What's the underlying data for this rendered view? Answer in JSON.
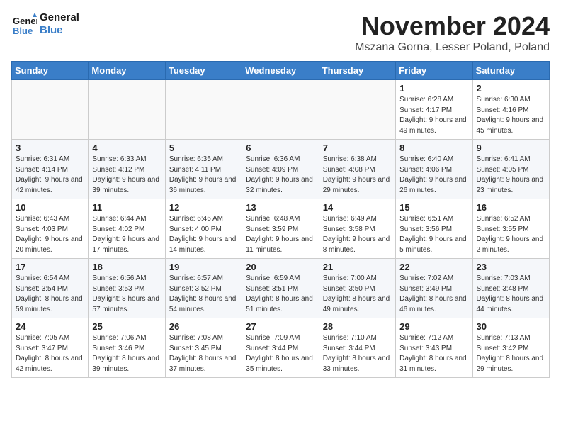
{
  "header": {
    "logo_line1": "General",
    "logo_line2": "Blue",
    "month": "November 2024",
    "location": "Mszana Gorna, Lesser Poland, Poland"
  },
  "weekdays": [
    "Sunday",
    "Monday",
    "Tuesday",
    "Wednesday",
    "Thursday",
    "Friday",
    "Saturday"
  ],
  "rows": [
    [
      {
        "day": "",
        "info": ""
      },
      {
        "day": "",
        "info": ""
      },
      {
        "day": "",
        "info": ""
      },
      {
        "day": "",
        "info": ""
      },
      {
        "day": "",
        "info": ""
      },
      {
        "day": "1",
        "info": "Sunrise: 6:28 AM\nSunset: 4:17 PM\nDaylight: 9 hours\nand 49 minutes."
      },
      {
        "day": "2",
        "info": "Sunrise: 6:30 AM\nSunset: 4:16 PM\nDaylight: 9 hours\nand 45 minutes."
      }
    ],
    [
      {
        "day": "3",
        "info": "Sunrise: 6:31 AM\nSunset: 4:14 PM\nDaylight: 9 hours\nand 42 minutes."
      },
      {
        "day": "4",
        "info": "Sunrise: 6:33 AM\nSunset: 4:12 PM\nDaylight: 9 hours\nand 39 minutes."
      },
      {
        "day": "5",
        "info": "Sunrise: 6:35 AM\nSunset: 4:11 PM\nDaylight: 9 hours\nand 36 minutes."
      },
      {
        "day": "6",
        "info": "Sunrise: 6:36 AM\nSunset: 4:09 PM\nDaylight: 9 hours\nand 32 minutes."
      },
      {
        "day": "7",
        "info": "Sunrise: 6:38 AM\nSunset: 4:08 PM\nDaylight: 9 hours\nand 29 minutes."
      },
      {
        "day": "8",
        "info": "Sunrise: 6:40 AM\nSunset: 4:06 PM\nDaylight: 9 hours\nand 26 minutes."
      },
      {
        "day": "9",
        "info": "Sunrise: 6:41 AM\nSunset: 4:05 PM\nDaylight: 9 hours\nand 23 minutes."
      }
    ],
    [
      {
        "day": "10",
        "info": "Sunrise: 6:43 AM\nSunset: 4:03 PM\nDaylight: 9 hours\nand 20 minutes."
      },
      {
        "day": "11",
        "info": "Sunrise: 6:44 AM\nSunset: 4:02 PM\nDaylight: 9 hours\nand 17 minutes."
      },
      {
        "day": "12",
        "info": "Sunrise: 6:46 AM\nSunset: 4:00 PM\nDaylight: 9 hours\nand 14 minutes."
      },
      {
        "day": "13",
        "info": "Sunrise: 6:48 AM\nSunset: 3:59 PM\nDaylight: 9 hours\nand 11 minutes."
      },
      {
        "day": "14",
        "info": "Sunrise: 6:49 AM\nSunset: 3:58 PM\nDaylight: 9 hours\nand 8 minutes."
      },
      {
        "day": "15",
        "info": "Sunrise: 6:51 AM\nSunset: 3:56 PM\nDaylight: 9 hours\nand 5 minutes."
      },
      {
        "day": "16",
        "info": "Sunrise: 6:52 AM\nSunset: 3:55 PM\nDaylight: 9 hours\nand 2 minutes."
      }
    ],
    [
      {
        "day": "17",
        "info": "Sunrise: 6:54 AM\nSunset: 3:54 PM\nDaylight: 8 hours\nand 59 minutes."
      },
      {
        "day": "18",
        "info": "Sunrise: 6:56 AM\nSunset: 3:53 PM\nDaylight: 8 hours\nand 57 minutes."
      },
      {
        "day": "19",
        "info": "Sunrise: 6:57 AM\nSunset: 3:52 PM\nDaylight: 8 hours\nand 54 minutes."
      },
      {
        "day": "20",
        "info": "Sunrise: 6:59 AM\nSunset: 3:51 PM\nDaylight: 8 hours\nand 51 minutes."
      },
      {
        "day": "21",
        "info": "Sunrise: 7:00 AM\nSunset: 3:50 PM\nDaylight: 8 hours\nand 49 minutes."
      },
      {
        "day": "22",
        "info": "Sunrise: 7:02 AM\nSunset: 3:49 PM\nDaylight: 8 hours\nand 46 minutes."
      },
      {
        "day": "23",
        "info": "Sunrise: 7:03 AM\nSunset: 3:48 PM\nDaylight: 8 hours\nand 44 minutes."
      }
    ],
    [
      {
        "day": "24",
        "info": "Sunrise: 7:05 AM\nSunset: 3:47 PM\nDaylight: 8 hours\nand 42 minutes."
      },
      {
        "day": "25",
        "info": "Sunrise: 7:06 AM\nSunset: 3:46 PM\nDaylight: 8 hours\nand 39 minutes."
      },
      {
        "day": "26",
        "info": "Sunrise: 7:08 AM\nSunset: 3:45 PM\nDaylight: 8 hours\nand 37 minutes."
      },
      {
        "day": "27",
        "info": "Sunrise: 7:09 AM\nSunset: 3:44 PM\nDaylight: 8 hours\nand 35 minutes."
      },
      {
        "day": "28",
        "info": "Sunrise: 7:10 AM\nSunset: 3:44 PM\nDaylight: 8 hours\nand 33 minutes."
      },
      {
        "day": "29",
        "info": "Sunrise: 7:12 AM\nSunset: 3:43 PM\nDaylight: 8 hours\nand 31 minutes."
      },
      {
        "day": "30",
        "info": "Sunrise: 7:13 AM\nSunset: 3:42 PM\nDaylight: 8 hours\nand 29 minutes."
      }
    ]
  ]
}
